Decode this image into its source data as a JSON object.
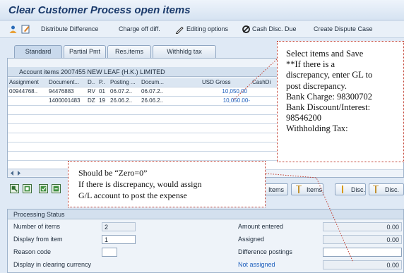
{
  "window": {
    "title": "Clear Customer Process open items"
  },
  "toolbar": {
    "distribute": "Distribute Difference",
    "charge_off": "Charge off diff.",
    "editing": "Editing options",
    "cash_disc": "Cash Disc. Due",
    "dispute": "Create Dispute Case"
  },
  "tabs": [
    "Standard",
    "Partial Pmt",
    "Res.items",
    "Withhldg tax"
  ],
  "items_panel": {
    "heading": "Account items 2007455 NEW LEAF (H.K.) LIMITED",
    "columns": [
      "Assignment",
      "Document...",
      "D..",
      "P..",
      "Posting ...",
      "Docum...",
      "USD Gross",
      "CashDi"
    ],
    "rows": [
      [
        "00944768..",
        "94476883",
        "RV",
        "01",
        "06.07.2..",
        "06.07.2..",
        "10,050.00",
        ""
      ],
      [
        "",
        "1400001483",
        "DZ",
        "19",
        "26.06.2..",
        "26.06.2..",
        "10,050.00-",
        ""
      ]
    ]
  },
  "item_buttons": [
    "Items",
    "Items",
    "Disc.",
    "Disc."
  ],
  "processing_status": {
    "heading": "Processing Status",
    "number_of_items_label": "Number of items",
    "number_of_items": "2",
    "display_from_item_label": "Display from item",
    "display_from_item": "1",
    "reason_code_label": "Reason code",
    "reason_code": "",
    "display_currency_label": "Display in clearing currency",
    "amount_entered_label": "Amount entered",
    "amount_entered": "0.00",
    "assigned_label": "Assigned",
    "assigned": "0.00",
    "difference_postings_label": "Difference postings",
    "difference_postings": "",
    "not_assigned_label": "Not assigned",
    "not_assigned": "0.00"
  },
  "callouts": {
    "top_right": [
      "Select items and Save",
      "**If there is a",
      "discrepancy, enter GL to",
      "post discrepancy.",
      "Bank Charge: 98300702",
      "Bank Discount/Interest:",
      "98546200",
      "Withholding Tax:"
    ],
    "bottom": [
      "Should be “Zero=0”",
      "If there is discrepancy, would assign",
      "G/L account to post the expense"
    ]
  },
  "colors": {
    "title": "#1a3a6b",
    "amount": "#1d5fbd",
    "callout_border": "#c0392b"
  }
}
